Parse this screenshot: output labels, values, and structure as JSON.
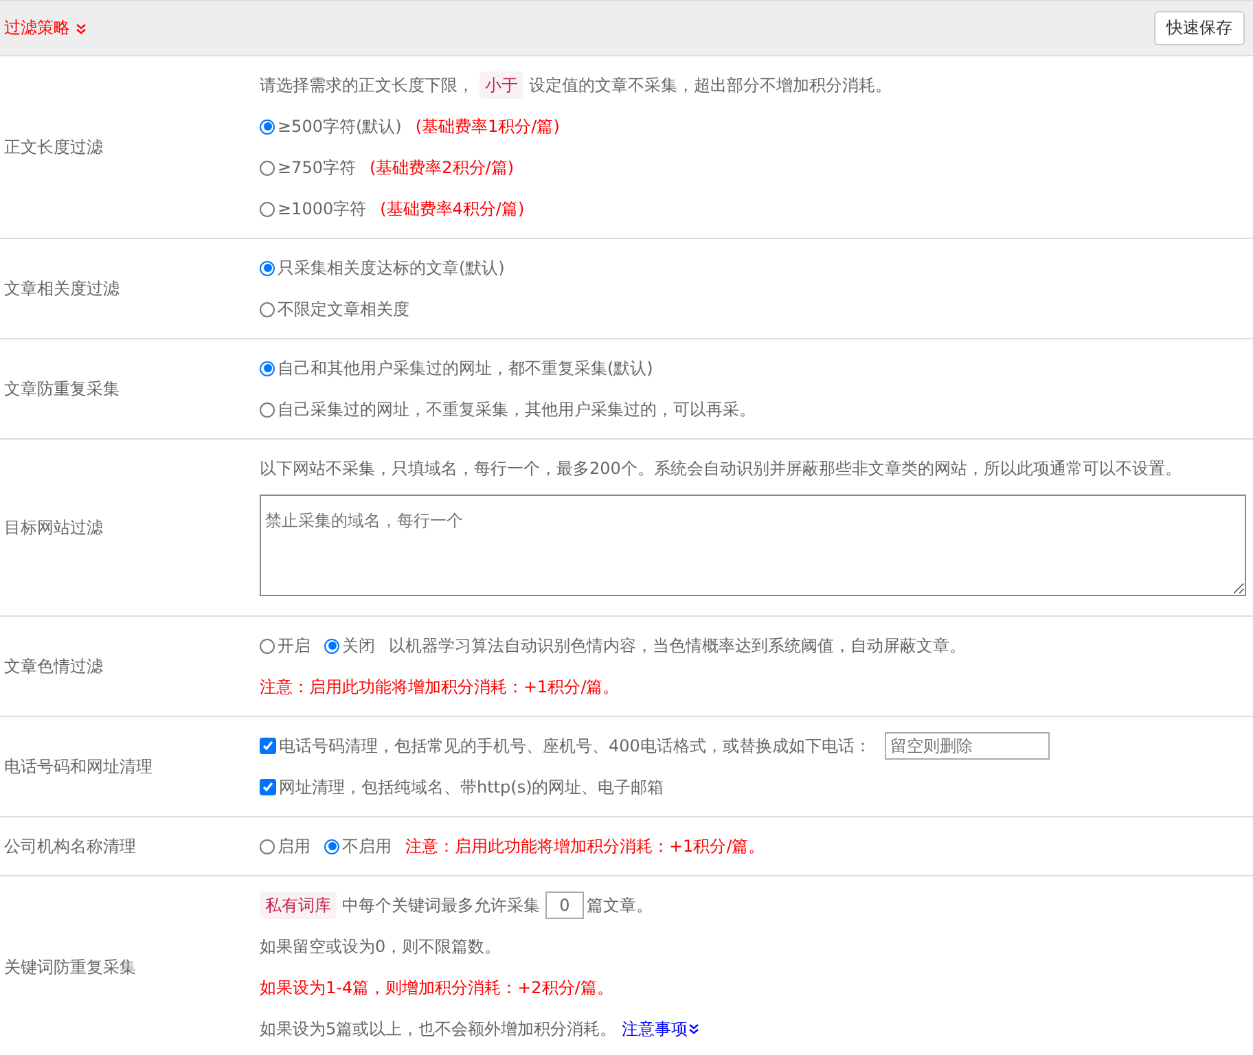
{
  "header": {
    "title": "过滤策略",
    "save_button": "快速保存"
  },
  "rows": [
    {
      "label": "正文长度过滤",
      "lines": [
        [
          {
            "kind": "text",
            "text": "请选择需求的正文长度下限，"
          },
          {
            "kind": "tag",
            "text": "小于"
          },
          {
            "kind": "text",
            "text": "设定值的文章不采集，超出部分不增加积分消耗。"
          }
        ],
        [
          {
            "kind": "radio",
            "text": "≥500字符(默认)",
            "selected": true
          },
          {
            "kind": "note",
            "text": "(基础费率1积分/篇)"
          }
        ],
        [
          {
            "kind": "radio",
            "text": "≥750字符",
            "selected": false
          },
          {
            "kind": "note",
            "text": "(基础费率2积分/篇)"
          }
        ],
        [
          {
            "kind": "radio",
            "text": "≥1000字符",
            "selected": false
          },
          {
            "kind": "note",
            "text": "(基础费率4积分/篇)"
          }
        ]
      ]
    },
    {
      "label": "文章相关度过滤",
      "lines": [
        [
          {
            "kind": "radio",
            "text": "只采集相关度达标的文章(默认)",
            "selected": true
          }
        ],
        [
          {
            "kind": "radio",
            "text": "不限定文章相关度",
            "selected": false
          }
        ]
      ]
    },
    {
      "label": "文章防重复采集",
      "lines": [
        [
          {
            "kind": "radio",
            "text": "自己和其他用户采集过的网址，都不重复采集(默认)",
            "selected": true
          }
        ],
        [
          {
            "kind": "radio",
            "text": "自己采集过的网址，不重复采集，其他用户采集过的，可以再采。",
            "selected": false
          }
        ]
      ]
    },
    {
      "label": "目标网站过滤",
      "lines": [
        [
          {
            "kind": "text",
            "text": "以下网站不采集，只填域名，每行一个，最多200个。系统会自动识别并屏蔽那些非文章类的网站，所以此项通常可以不设置。"
          }
        ],
        [
          {
            "kind": "textarea",
            "placeholder": "禁止采集的域名，每行一个"
          }
        ]
      ]
    },
    {
      "label": "文章色情过滤",
      "lines": [
        [
          {
            "kind": "radio",
            "text": "开启",
            "selected": false
          },
          {
            "kind": "radio",
            "text": "关闭",
            "selected": true
          },
          {
            "kind": "text",
            "text": "以机器学习算法自动识别色情内容，当色情概率达到系统阈值，自动屏蔽文章。"
          }
        ],
        [
          {
            "kind": "note",
            "text": "注意：启用此功能将增加积分消耗：+1积分/篇。"
          }
        ]
      ]
    },
    {
      "label": "电话号码和网址清理",
      "lines": [
        [
          {
            "kind": "checkbox",
            "text": "电话号码清理，包括常见的手机号、座机号、400电话格式，或替换成如下电话：",
            "checked": true
          },
          {
            "kind": "input",
            "placeholder": "留空则删除"
          }
        ],
        [
          {
            "kind": "checkbox",
            "text": "网址清理，包括纯域名、带http(s)的网址、电子邮箱",
            "checked": true
          }
        ]
      ]
    },
    {
      "label": "公司机构名称清理",
      "lines": [
        [
          {
            "kind": "radio",
            "text": "启用",
            "selected": false
          },
          {
            "kind": "radio",
            "text": "不启用",
            "selected": true
          },
          {
            "kind": "note",
            "text": "注意：启用此功能将增加积分消耗：+1积分/篇。"
          }
        ]
      ]
    },
    {
      "label": "关键词防重复采集",
      "lines": [
        [
          {
            "kind": "tag",
            "text": "私有词库"
          },
          {
            "kind": "text",
            "text": "中每个关键词最多允许采集"
          },
          {
            "kind": "number",
            "value": "0"
          },
          {
            "kind": "text",
            "text": "篇文章。"
          }
        ],
        [
          {
            "kind": "text",
            "text": "如果留空或设为0，则不限篇数。"
          }
        ],
        [
          {
            "kind": "note",
            "text": "如果设为1-4篇，则增加积分消耗：+2积分/篇。"
          }
        ],
        [
          {
            "kind": "text",
            "text": "如果设为5篇或以上，也不会额外增加积分消耗。"
          },
          {
            "kind": "link",
            "text": "注意事项"
          }
        ]
      ]
    }
  ]
}
